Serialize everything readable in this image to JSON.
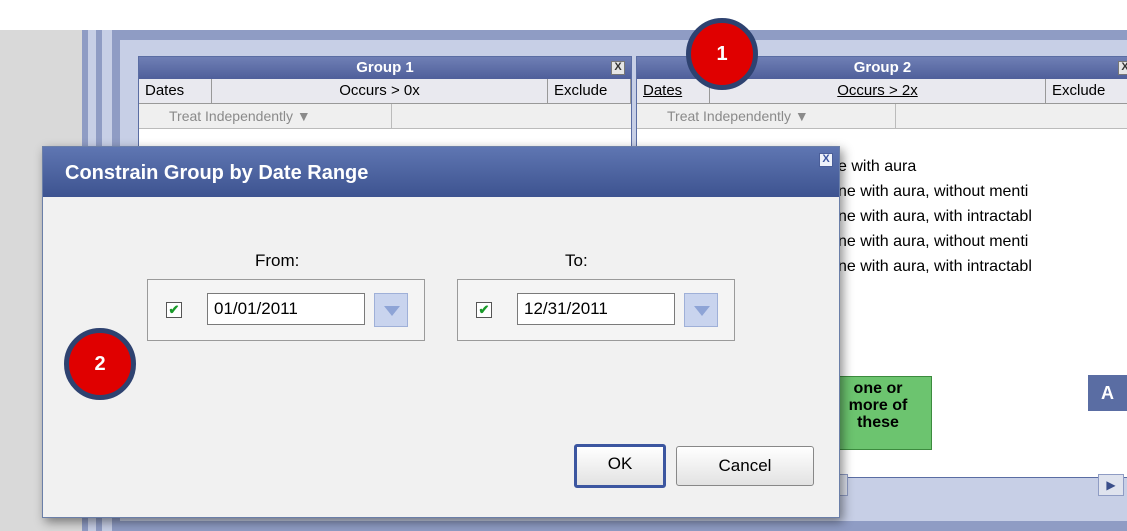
{
  "groups": [
    {
      "title": "Group 1",
      "close_glyph": "X",
      "col_dates": "Dates",
      "col_occurs": "Occurs > 0x",
      "col_exclude": "Exclude",
      "treat": "Treat Independently ▼"
    },
    {
      "title": "Group 2",
      "close_glyph": "X",
      "col_dates": "Dates",
      "col_occurs": "Occurs > 2x",
      "col_exclude": "Exclude",
      "treat": "Treat Independently ▼"
    }
  ],
  "concepts": [
    "e with aura",
    "ne with aura, without menti",
    "ne with aura, with intractabl",
    "ne with aura, without menti",
    "ne with aura, with intractabl"
  ],
  "green_box": [
    "one or",
    "more of",
    "these"
  ],
  "a_button": "A",
  "scroll_right": "▶",
  "dialog": {
    "title": "Constrain Group by Date Range",
    "close_glyph": "X",
    "from_label": "From:",
    "to_label": "To:",
    "from_checked": "✔",
    "to_checked": "✔",
    "from_value": "01/01/2011",
    "to_value": "12/31/2011",
    "ok": "OK",
    "cancel": "Cancel"
  },
  "badges": [
    "1",
    "2"
  ],
  "colors": {
    "badge_fill": "#e00000",
    "dialog_header": "#4a5f9e",
    "green_box": "#6cc46f"
  }
}
